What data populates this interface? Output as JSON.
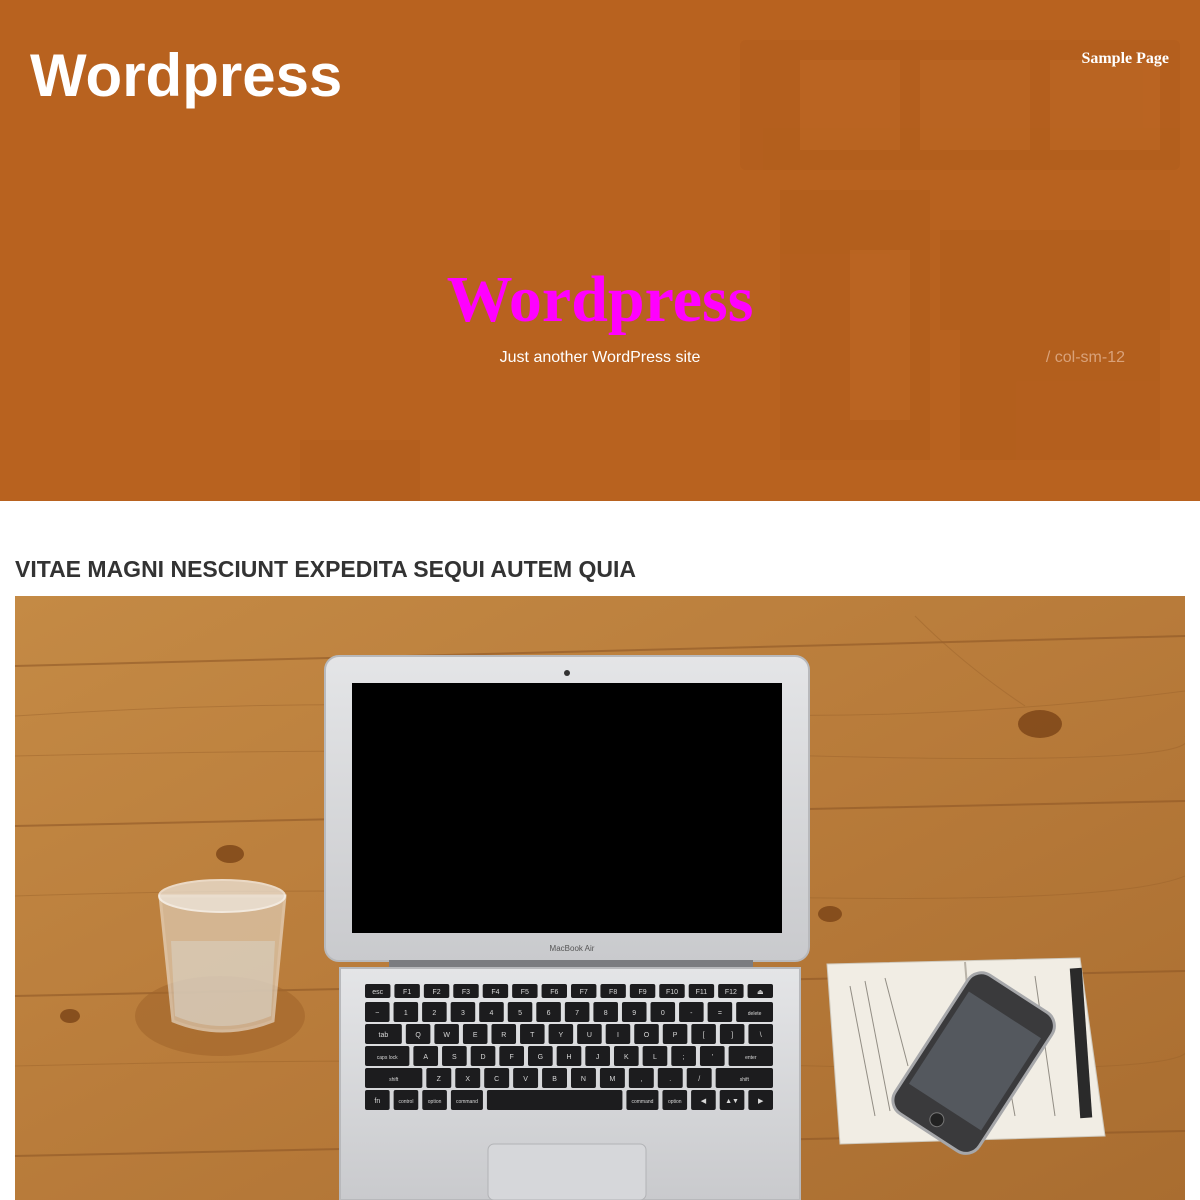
{
  "header": {
    "site_title": "Wordpress",
    "nav": [
      {
        "label": "Sample Page"
      }
    ]
  },
  "hero": {
    "title": "Wordpress",
    "tagline": "Just another WordPress site",
    "comment": "/ col-sm-12",
    "background_color": "#b8621f",
    "title_color": "#ff00ff"
  },
  "post": {
    "title": "VITAE MAGNI NESCIUNT EXPEDITA SEQUI AUTEM QUIA",
    "image": {
      "laptop_label": "MacBook Air",
      "keys_row1": [
        "esc",
        "F1",
        "F2",
        "F3",
        "F4",
        "F5",
        "F6",
        "F7",
        "F8",
        "F9",
        "F10",
        "F11",
        "F12",
        "⏏"
      ],
      "keys_row2": [
        "~",
        "1",
        "2",
        "3",
        "4",
        "5",
        "6",
        "7",
        "8",
        "9",
        "0",
        "-",
        "=",
        "delete"
      ],
      "keys_row3": [
        "tab",
        "Q",
        "W",
        "E",
        "R",
        "T",
        "Y",
        "U",
        "I",
        "O",
        "P",
        "[",
        "]",
        "\\"
      ],
      "keys_row4": [
        "caps lock",
        "A",
        "S",
        "D",
        "F",
        "G",
        "H",
        "J",
        "K",
        "L",
        ";",
        "'",
        "enter"
      ],
      "keys_row5": [
        "shift",
        "Z",
        "X",
        "C",
        "V",
        "B",
        "N",
        "M",
        ",",
        ".",
        "/",
        "shift"
      ],
      "keys_row6": [
        "fn",
        "control",
        "option",
        "command",
        "",
        "command",
        "option",
        "◀",
        "▲▼",
        "▶"
      ]
    }
  }
}
